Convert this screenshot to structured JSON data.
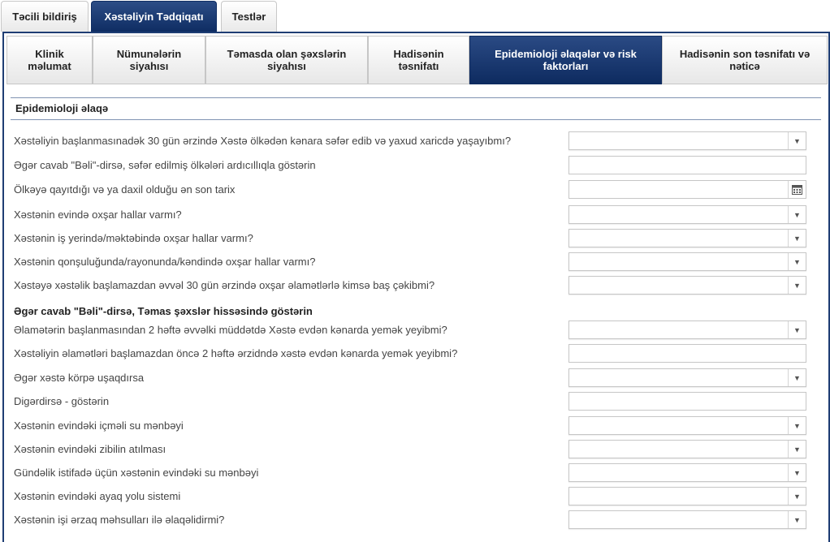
{
  "top_tabs": [
    {
      "label": "Təcili bildiriş"
    },
    {
      "label": "Xəstəliyin Tədqiqatı"
    },
    {
      "label": "Testlər"
    }
  ],
  "sub_tabs": [
    {
      "label": "Klinik məlumat"
    },
    {
      "label": "Nümunələrin siyahısı"
    },
    {
      "label": "Təmasda olan şəxslərin siyahısı"
    },
    {
      "label": "Hadisənin təsnifatı"
    },
    {
      "label": "Epidemioloji əlaqələr və risk faktorları"
    },
    {
      "label": "Hadisənin son təsnifatı və nəticə"
    }
  ],
  "section": {
    "title": "Epidemioloji əlaqə"
  },
  "rows": [
    {
      "label": "Xəstəliyin başlanmasınadək 30 gün ərzində Xəstə ölkədən kənara səfər edib və yaxud xaricdə yaşayıbmı?",
      "control": "select",
      "value": ""
    },
    {
      "label": "Əgər cavab \"Bəli\"-dirsə, səfər edilmiş ölkələri ardıcıllıqla göstərin",
      "control": "text",
      "value": ""
    },
    {
      "label": "Ölkəyə qayıtdığı və ya daxil olduğu ən son tarix",
      "control": "date",
      "value": ""
    },
    {
      "label": "Xəstənin evində oxşar hallar varmı?",
      "control": "select",
      "value": ""
    },
    {
      "label": "Xəstənin iş yerində/məktəbində oxşar hallar varmı?",
      "control": "select",
      "value": ""
    },
    {
      "label": "Xəstənin qonşuluğunda/rayonunda/kəndində oxşar hallar varmı?",
      "control": "select",
      "value": ""
    },
    {
      "label": "Xəstəyə xəstəlik başlamazdan əvvəl 30 gün ərzində oxşar əlamətlərlə kimsə baş çəkibmi?",
      "control": "select",
      "value": ""
    },
    {
      "label": "Əgər cavab \"Bəli\"-dirsə, Təmas şəxslər hissəsində göstərin",
      "control": "none",
      "value": ""
    },
    {
      "label": "Əlamətərin başlanmasından 2 həftə əvvəlki müddətdə Xəstə evdən kənarda yemək yeyibmi?",
      "control": "select",
      "value": ""
    },
    {
      "label": "Xəstəliyin əlamətləri başlamazdan öncə 2 həftə ərzidndə xəstə evdən kənarda yemək yeyibmi?",
      "control": "text",
      "value": ""
    },
    {
      "label": "Əgər xəstə körpə uşaqdırsa",
      "control": "select",
      "value": ""
    },
    {
      "label": "Digərdirsə - göstərin",
      "control": "text",
      "value": ""
    },
    {
      "label": "Xəstənin evindəki içməli su mənbəyi",
      "control": "select",
      "value": ""
    },
    {
      "label": "Xəstənin evindəki zibilin atılması",
      "control": "select",
      "value": ""
    },
    {
      "label": "Gündəlik istifadə üçün xəstənin evindəki su mənbəyi",
      "control": "select",
      "value": ""
    },
    {
      "label": "Xəstənin evindəki ayaq yolu sistemi",
      "control": "select",
      "value": ""
    },
    {
      "label": "Xəstənin işi ərzaq məhsulları ilə əlaqəlidirmi?",
      "control": "select",
      "value": ""
    }
  ],
  "icons": {
    "dropdown": "chevron-down-icon",
    "calendar": "calendar-icon"
  },
  "colors": {
    "accent": "#0f2d63",
    "border": "#c6c6c6"
  }
}
